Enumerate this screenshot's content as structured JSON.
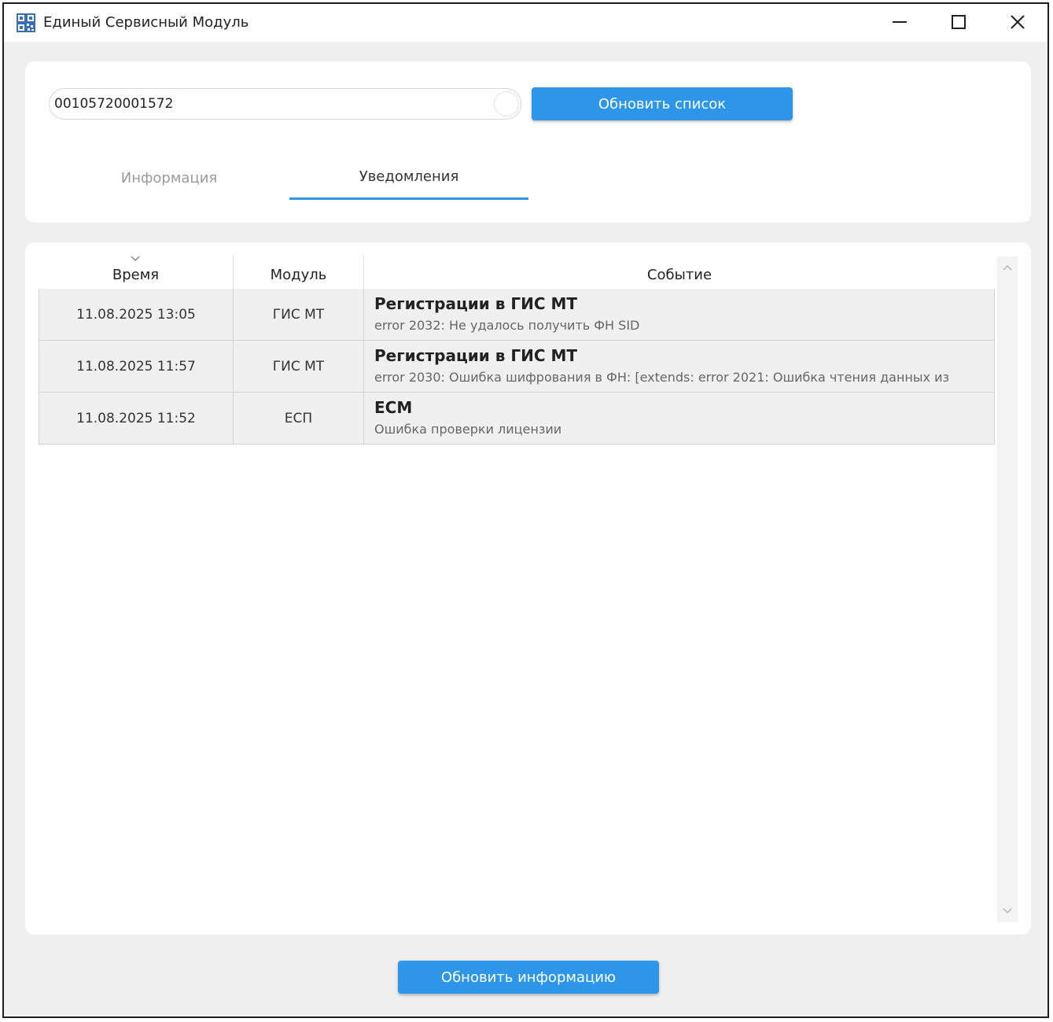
{
  "window": {
    "title": "Единый Сервисный Модуль"
  },
  "search": {
    "value": "00105720001572"
  },
  "buttons": {
    "refresh_list": "Обновить список",
    "refresh_info": "Обновить информацию"
  },
  "tabs": [
    {
      "label": "Информация",
      "active": false
    },
    {
      "label": "Уведомления",
      "active": true
    }
  ],
  "table": {
    "columns": {
      "time": "Время",
      "module": "Модуль",
      "event": "Событие"
    },
    "rows": [
      {
        "time": "11.08.2025 13:05",
        "module": "ГИС МТ",
        "event_title": "Регистрации в ГИС МТ",
        "event_desc": "error 2032: Не удалось получить ФН SID"
      },
      {
        "time": "11.08.2025 11:57",
        "module": "ГИС МТ",
        "event_title": "Регистрации в ГИС МТ",
        "event_desc": "error 2030: Ошибка шифрования в ФН: [extends: error 2021: Ошибка чтения данных из"
      },
      {
        "time": "11.08.2025 11:52",
        "module": "ЕСП",
        "event_title": "ЕСМ",
        "event_desc": "Ошибка проверки лицензии"
      }
    ]
  },
  "icons": {
    "app": "qr-code-icon",
    "minimize": "minimize-icon",
    "maximize": "maximize-icon",
    "close": "close-icon",
    "sort": "chevron-down-icon"
  },
  "colors": {
    "accent": "#2d96e8",
    "window_bg": "#efefef",
    "panel_bg": "#ffffff",
    "row_bg": "#f0f0f0"
  }
}
